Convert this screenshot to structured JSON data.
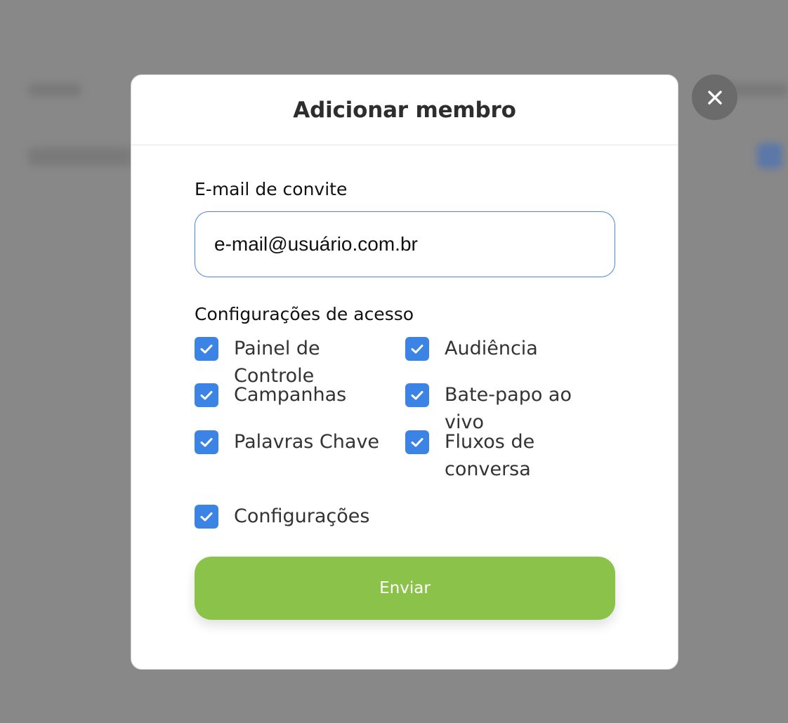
{
  "modal": {
    "title": "Adicionar membro",
    "email_label": "E-mail de convite",
    "email_value": "e-mail@usuário.com.br",
    "access_label": "Configurações de acesso",
    "permissions": [
      {
        "label": "Painel de Controle",
        "checked": true
      },
      {
        "label": "Audiência",
        "checked": true
      },
      {
        "label": "Campanhas",
        "checked": true
      },
      {
        "label": "Bate-papo ao vivo",
        "checked": true
      },
      {
        "label": "Palavras Chave",
        "checked": true
      },
      {
        "label": "Fluxos de conversa",
        "checked": true
      },
      {
        "label": "Configurações",
        "checked": true
      }
    ],
    "submit_label": "Enviar"
  },
  "icons": {
    "close": "close-icon",
    "check": "check-icon"
  },
  "colors": {
    "overlay": "#888888",
    "checkbox": "#3c83e6",
    "submit": "#8bc34a",
    "input_border": "#4a86e0",
    "close_button": "#6b6b6b"
  }
}
